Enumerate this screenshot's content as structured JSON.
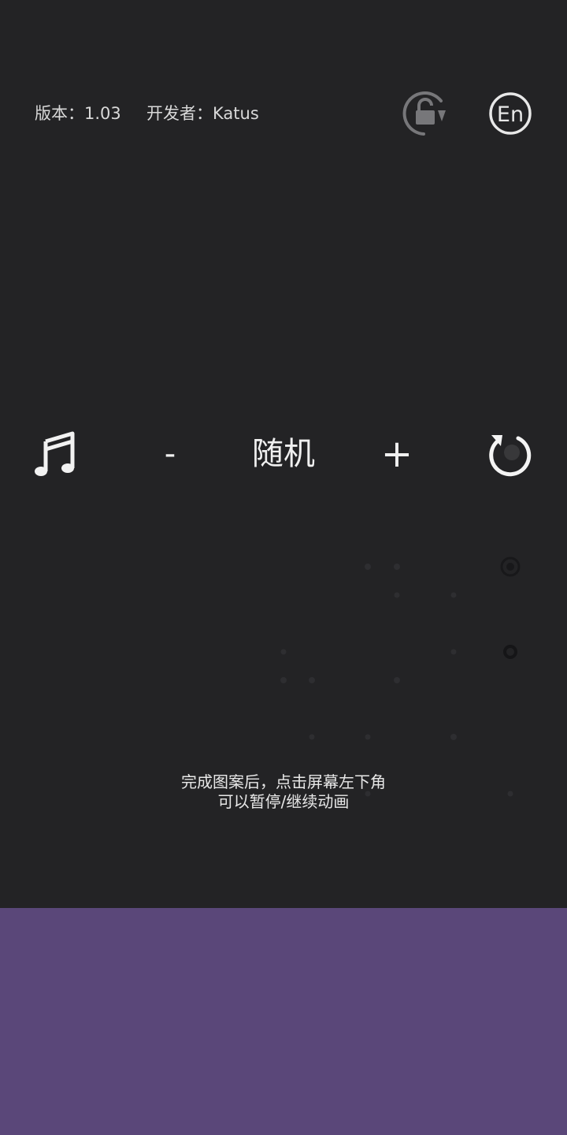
{
  "header": {
    "version": "版本：1.03",
    "developer": "开发者：Katus",
    "rotate_lock_icon": "rotate-unlock-icon",
    "language_icon": "en-language-icon",
    "language_label": "En"
  },
  "controls": {
    "music_icon": "music-note-icon",
    "minus_label": "-",
    "mode_label": "随机",
    "plus_label": "+",
    "refresh_icon": "refresh-icon"
  },
  "hint": {
    "line1": "完成图案后，点击屏幕左下角",
    "line2": "可以暂停/继续动画"
  },
  "colors": {
    "background": "#232325",
    "bottom_panel": "#5a4779",
    "text": "#e6e6e6",
    "icon_dim": "#8a8a8c"
  }
}
